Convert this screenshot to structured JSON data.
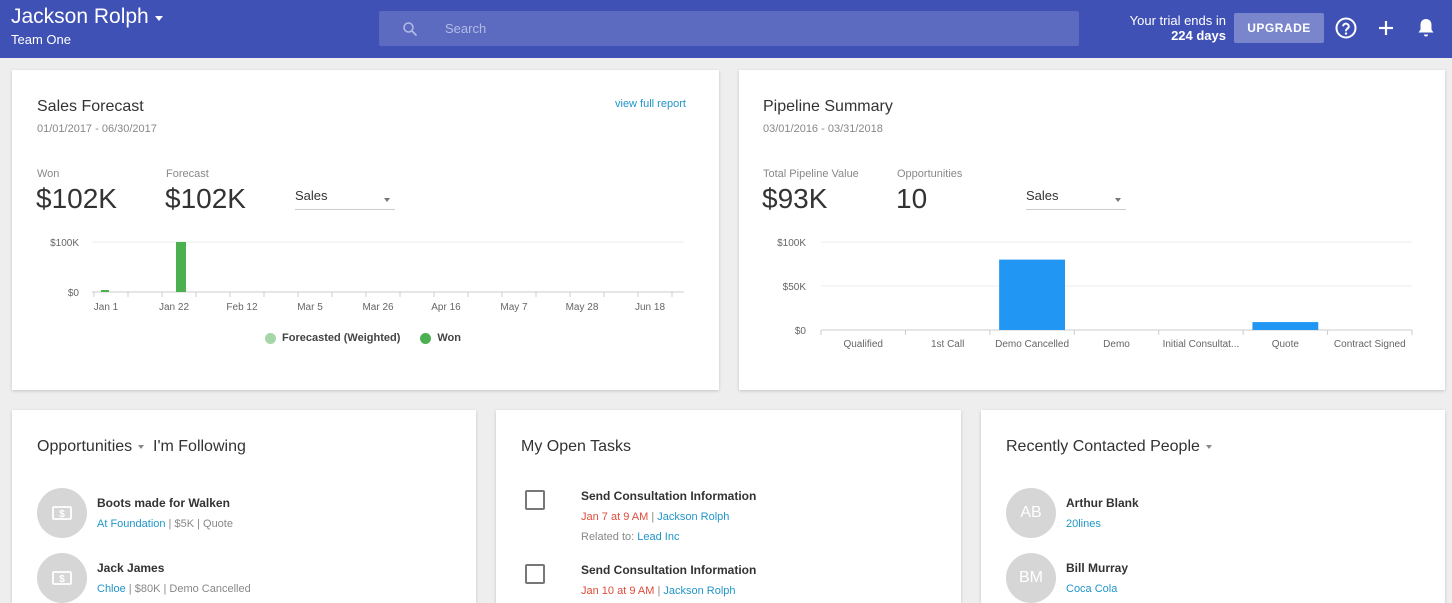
{
  "header": {
    "user_name": "Jackson Rolph",
    "team_name": "Team One",
    "search_placeholder": "Search",
    "trial_text": "Your trial ends in",
    "trial_days": "224 days",
    "upgrade_label": "UPGRADE"
  },
  "sales_forecast": {
    "title": "Sales Forecast",
    "date_range": "01/01/2017 - 06/30/2017",
    "view_link": "view full report",
    "won_label": "Won",
    "won_value": "$102K",
    "forecast_label": "Forecast",
    "forecast_value": "$102K",
    "select_value": "Sales",
    "legend": [
      {
        "label": "Forecasted (Weighted)",
        "color": "#a5d6a7"
      },
      {
        "label": "Won",
        "color": "#4caf50"
      }
    ]
  },
  "pipeline_summary": {
    "title": "Pipeline Summary",
    "date_range": "03/01/2016 - 03/31/2018",
    "total_label": "Total Pipeline Value",
    "total_value": "$93K",
    "opps_label": "Opportunities",
    "opps_value": "10",
    "select_value": "Sales"
  },
  "opportunities": {
    "title": "Opportunities",
    "filter": "I'm Following",
    "items": [
      {
        "name": "Boots made for Walken",
        "company": "At Foundation",
        "details": " | $5K | Quote"
      },
      {
        "name": "Jack James",
        "company": "Chloe",
        "details": " | $80K | Demo Cancelled"
      }
    ]
  },
  "tasks": {
    "title": "My Open Tasks",
    "items": [
      {
        "title": "Send Consultation Information",
        "due": "Jan 7 at 9 AM",
        "owner": "Jackson Rolph",
        "related_label": "Related to: ",
        "related": "Lead Inc"
      },
      {
        "title": "Send Consultation Information",
        "due": "Jan 10 at 9 AM",
        "owner": "Jackson Rolph"
      }
    ]
  },
  "people": {
    "title": "Recently Contacted People",
    "items": [
      {
        "initials": "AB",
        "name": "Arthur Blank",
        "company": "20lines"
      },
      {
        "initials": "BM",
        "name": "Bill Murray",
        "company": "Coca Cola"
      }
    ]
  },
  "chart_data": [
    {
      "type": "bar",
      "title": "",
      "categories": [
        "Jan 1",
        "Jan 22",
        "Feb 12",
        "Mar 5",
        "Mar 26",
        "Apr 16",
        "May 7",
        "May 28",
        "Jun 18"
      ],
      "y_ticks": [
        "$100K",
        "$0"
      ],
      "ylim": [
        0,
        100
      ],
      "series": [
        {
          "name": "Forecasted (Weighted)",
          "color": "#a5d6a7",
          "values": [
            0,
            0,
            0,
            0,
            0,
            0,
            0,
            0,
            0
          ]
        },
        {
          "name": "Won",
          "color": "#4caf50",
          "values": [
            1,
            100,
            0,
            0,
            0,
            0,
            0,
            0,
            0
          ]
        }
      ],
      "grid": true
    },
    {
      "type": "bar",
      "title": "",
      "categories": [
        "Qualified",
        "1st Call",
        "Demo Cancelled",
        "Demo",
        "Initial Consultat...",
        "Quote",
        "Contract Signed"
      ],
      "y_ticks": [
        "$100K",
        "$50K",
        "$0"
      ],
      "ylim": [
        0,
        100
      ],
      "values": [
        0,
        0,
        80,
        0,
        0,
        9,
        0
      ],
      "color": "#2196f3",
      "grid": true
    }
  ]
}
